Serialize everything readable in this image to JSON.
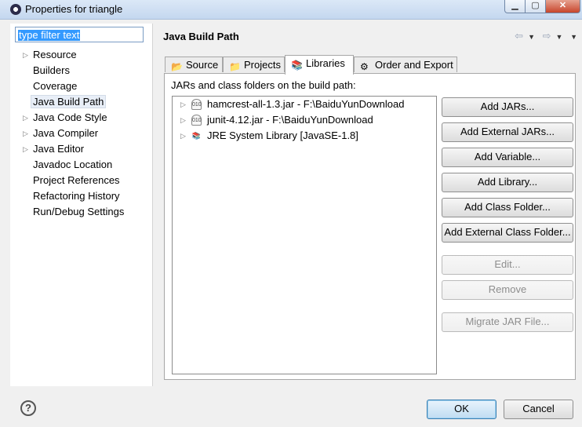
{
  "window": {
    "title": "Properties for triangle"
  },
  "filter": {
    "value": "type filter text"
  },
  "tree": [
    {
      "label": "Resource",
      "expandable": true
    },
    {
      "label": "Builders",
      "expandable": false
    },
    {
      "label": "Coverage",
      "expandable": false
    },
    {
      "label": "Java Build Path",
      "expandable": false,
      "selected": true
    },
    {
      "label": "Java Code Style",
      "expandable": true
    },
    {
      "label": "Java Compiler",
      "expandable": true
    },
    {
      "label": "Java Editor",
      "expandable": true
    },
    {
      "label": "Javadoc Location",
      "expandable": false
    },
    {
      "label": "Project References",
      "expandable": false
    },
    {
      "label": "Refactoring History",
      "expandable": false
    },
    {
      "label": "Run/Debug Settings",
      "expandable": false
    }
  ],
  "page": {
    "title": "Java Build Path"
  },
  "tabs": [
    {
      "label": "Source",
      "icon": "source-folder-icon"
    },
    {
      "label": "Projects",
      "icon": "projects-icon"
    },
    {
      "label": "Libraries",
      "icon": "libraries-icon",
      "active": true
    },
    {
      "label": "Order and Export",
      "icon": "order-export-icon"
    }
  ],
  "libraries": {
    "section_label": "JARs and class folders on the build path:",
    "items": [
      {
        "label": "hamcrest-all-1.3.jar - F:\\BaiduYunDownload",
        "icon": "jar-icon"
      },
      {
        "label": "junit-4.12.jar - F:\\BaiduYunDownload",
        "icon": "jar-icon"
      },
      {
        "label": "JRE System Library [JavaSE-1.8]",
        "icon": "library-icon"
      }
    ]
  },
  "buttons": {
    "add_jars": "Add JARs...",
    "add_external_jars": "Add External JARs...",
    "add_variable": "Add Variable...",
    "add_library": "Add Library...",
    "add_class_folder": "Add Class Folder...",
    "add_external_class_folder": "Add External Class Folder...",
    "edit": "Edit...",
    "remove": "Remove",
    "migrate_jar": "Migrate JAR File..."
  },
  "footer": {
    "ok": "OK",
    "cancel": "Cancel"
  }
}
